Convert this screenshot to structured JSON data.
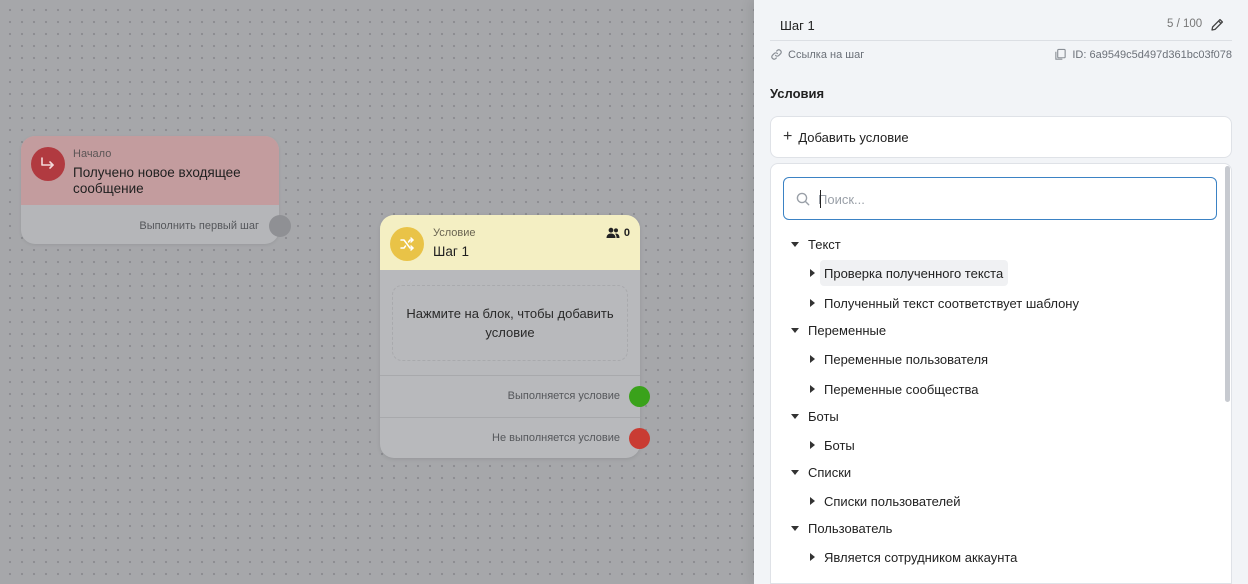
{
  "canvas": {
    "start_node": {
      "eyebrow": "Начало",
      "title": "Получено новое входящее сообщение",
      "exit_label": "Выполнить первый шаг",
      "icon": "arrow-turn-right-icon",
      "color": "#b13a40"
    },
    "condition_node": {
      "eyebrow": "Условие",
      "title": "Шаг 1",
      "user_count": "0",
      "body_text": "Нажмите на блок, чтобы добавить условие",
      "out_true": "Выполняется условие",
      "out_false": "Не выполняется условие",
      "icon": "shuffle-icon",
      "color": "#e9c347",
      "true_color": "#3aa21b",
      "false_color": "#c93c33"
    }
  },
  "panel": {
    "step_name": "Шаг 1",
    "step_counter": "5 / 100",
    "link_label": "Ссылка на шаг",
    "id_label": "ID: 6a9549c5d497d361bc03f078",
    "section_title": "Условия",
    "add_condition_label": "Добавить условие",
    "search_placeholder": "Поиск...",
    "tree": [
      {
        "label": "Текст",
        "items": [
          "Проверка полученного текста",
          "Полученный текст соответствует шаблону"
        ]
      },
      {
        "label": "Переменные",
        "items": [
          "Переменные пользователя",
          "Переменные сообщества"
        ]
      },
      {
        "label": "Боты",
        "items": [
          "Боты"
        ]
      },
      {
        "label": "Списки",
        "items": [
          "Списки пользователей"
        ]
      },
      {
        "label": "Пользователь",
        "items": [
          "Является сотрудником аккаунта"
        ]
      }
    ]
  }
}
